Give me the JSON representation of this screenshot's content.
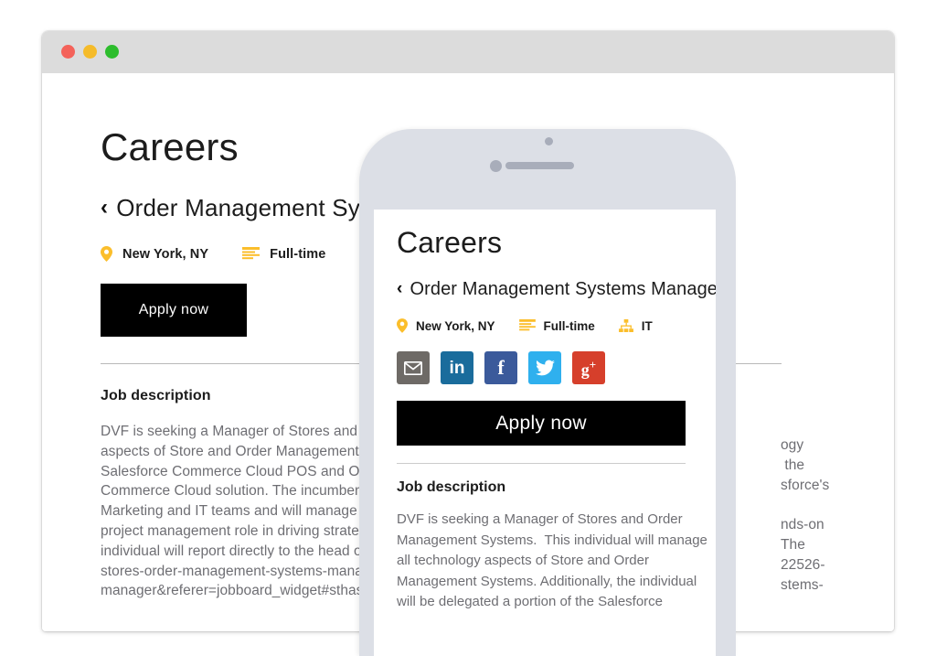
{
  "browser": {
    "traffic_lights": [
      {
        "name": "close",
        "color": "#f4625a"
      },
      {
        "name": "minimize",
        "color": "#f5bb2a"
      },
      {
        "name": "maximize",
        "color": "#2dbd2d"
      }
    ]
  },
  "desktop": {
    "page_title": "Careers",
    "back_chevron": "‹",
    "job_title": "Order Management Sy",
    "meta": {
      "location_icon": "map-pin-icon",
      "location": "New York, NY",
      "type_icon": "list-lines-icon",
      "employment_type": "Full-time",
      "department_icon": "sitemap-icon",
      "department": ""
    },
    "apply_label": "Apply now",
    "section_title": "Job description",
    "description_left": "DVF is seeking a Manager of Stores and O\naspects of Store and Order Management S\nSalesforce Commerce Cloud POS and Ord\nCommerce Cloud solution. The incumbent v\nMarketing and IT teams and will manage th\nproject management role in driving strategi\nindividual will report directly to the head of\nstores-order-management-systems-manager/\nmanager&referer=jobboard_widget#sthash",
    "description_right": "ogy\n the\nsforce's\n\nnds-on\nThe\n22526-\nstems-"
  },
  "phone": {
    "page_title": "Careers",
    "back_chevron": "‹",
    "job_title": "Order Management Systems Manager",
    "meta": {
      "location_icon": "map-pin-icon",
      "location": "New York, NY",
      "type_icon": "list-lines-icon",
      "employment_type": "Full-time",
      "department_icon": "sitemap-icon",
      "department": "IT"
    },
    "share_buttons": [
      {
        "name": "email-share-button",
        "icon": "envelope-icon",
        "label": "Email",
        "color": "#6e6a66"
      },
      {
        "name": "linkedin-share-button",
        "icon": "linkedin-icon",
        "label": "in",
        "color": "#1a6c9c"
      },
      {
        "name": "facebook-share-button",
        "icon": "facebook-icon",
        "label": "f",
        "color": "#3b5a9b"
      },
      {
        "name": "twitter-share-button",
        "icon": "twitter-icon",
        "label": "Twitter",
        "color": "#2fb0ee"
      },
      {
        "name": "googleplus-share-button",
        "icon": "google-plus-icon",
        "label": "g+",
        "color": "#d63f2b"
      }
    ],
    "apply_label": "Apply now",
    "section_title": "Job description",
    "description": "DVF is seeking a Manager of Stores and Order\nManagement Systems.  This individual will manage\nall technology aspects of Store and Order\nManagement Systems. Additionally, the individual\nwill be delegated a portion of the Salesforce"
  },
  "colors": {
    "accent_yellow": "#fbbe2b",
    "browser_chrome": "#dcdcdc",
    "phone_body": "#dcdfe6",
    "phone_detail": "#a8adba",
    "body_text": "#6e6e73",
    "heading_text": "#1c1c1c",
    "button_black": "#000000"
  }
}
